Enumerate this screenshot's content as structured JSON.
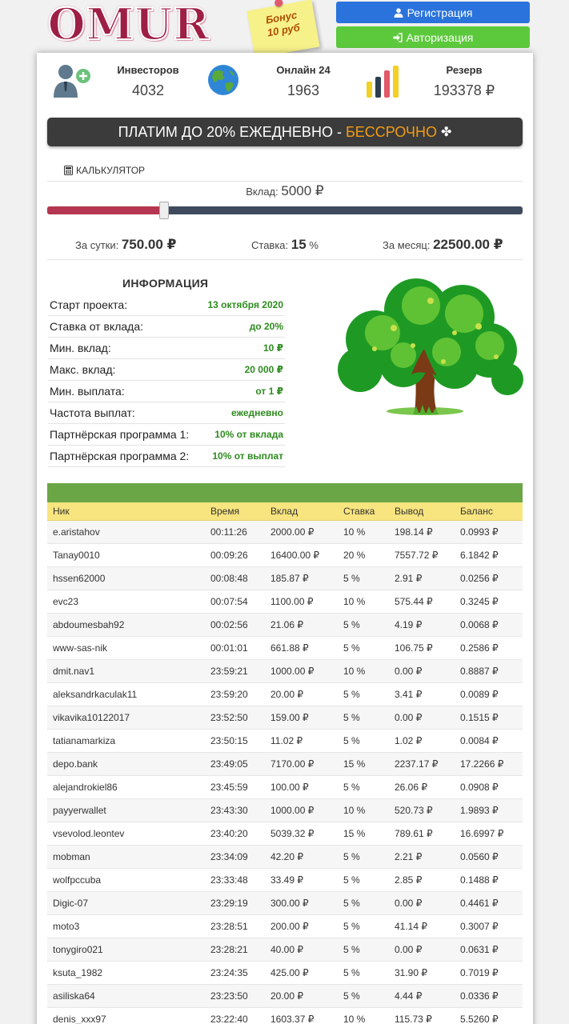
{
  "header": {
    "logo_text": "OMUR",
    "bonus_line1": "Бонус",
    "bonus_line2": "10 руб",
    "register_label": "Регистрация",
    "login_label": "Авторизация"
  },
  "stats": {
    "investors_label": "Инвесторов",
    "investors_value": "4032",
    "online_label": "Онлайн 24",
    "online_value": "1963",
    "reserve_label": "Резерв",
    "reserve_value": "193378 ₽"
  },
  "banner": {
    "text": "ПЛАТИМ ДО 20% ЕЖЕДНЕВНО -",
    "accent": "БЕССРОЧНО"
  },
  "calculator": {
    "title": "КАЛЬКУЛЯТОР",
    "deposit_label": "Вклад:",
    "deposit_value": "5000 ₽",
    "slider_fraction": 0.246,
    "daily_label": "За сутки:",
    "daily_value": "750.00 ₽",
    "rate_label": "Ставка:",
    "rate_value": "15",
    "rate_unit": "%",
    "monthly_label": "За месяц:",
    "monthly_value": "22500.00 ₽"
  },
  "info": {
    "title": "ИНФОРМАЦИЯ",
    "rows": [
      {
        "label": "Старт проекта:",
        "value": "13 октября 2020"
      },
      {
        "label": "Ставка от вклада:",
        "value": "до 20%"
      },
      {
        "label": "Мин. вклад:",
        "value": "10 ₽"
      },
      {
        "label": "Макс. вклад:",
        "value": "20 000 ₽"
      },
      {
        "label": "Мин. выплата:",
        "value": "от 1 ₽"
      },
      {
        "label": "Частота выплат:",
        "value": "ежедневно"
      },
      {
        "label": "Партнёрская программа 1:",
        "value": "10% от вклада"
      },
      {
        "label": "Партнёрская программа 2:",
        "value": "10% от выплат"
      }
    ]
  },
  "table": {
    "columns": [
      "Ник",
      "Время",
      "Вклад",
      "Ставка",
      "Вывод",
      "Баланс"
    ],
    "rows": [
      [
        "e.aristahov",
        "00:11:26",
        "2000.00 ₽",
        "10 %",
        "198.14 ₽",
        "0.0993 ₽"
      ],
      [
        "Tanay0010",
        "00:09:26",
        "16400.00 ₽",
        "20 %",
        "7557.72 ₽",
        "6.1842 ₽"
      ],
      [
        "hssen62000",
        "00:08:48",
        "185.87 ₽",
        "5 %",
        "2.91 ₽",
        "0.0256 ₽"
      ],
      [
        "evc23",
        "00:07:54",
        "1100.00 ₽",
        "10 %",
        "575.44 ₽",
        "0.3245 ₽"
      ],
      [
        "abdoumesbah92",
        "00:02:56",
        "21.06 ₽",
        "5 %",
        "4.19 ₽",
        "0.0068 ₽"
      ],
      [
        "www-sas-nik",
        "00:01:01",
        "661.88 ₽",
        "5 %",
        "106.75 ₽",
        "0.2586 ₽"
      ],
      [
        "dmit.nav1",
        "23:59:21",
        "1000.00 ₽",
        "10 %",
        "0.00 ₽",
        "0.8887 ₽"
      ],
      [
        "aleksandrkaculak11",
        "23:59:20",
        "20.00 ₽",
        "5 %",
        "3.41 ₽",
        "0.0089 ₽"
      ],
      [
        "vikavika10122017",
        "23:52:50",
        "159.00 ₽",
        "5 %",
        "0.00 ₽",
        "0.1515 ₽"
      ],
      [
        "tatianamarkiza",
        "23:50:15",
        "11.02 ₽",
        "5 %",
        "1.02 ₽",
        "0.0084 ₽"
      ],
      [
        "depo.bank",
        "23:49:05",
        "7170.00 ₽",
        "15 %",
        "2237.17 ₽",
        "17.2266 ₽"
      ],
      [
        "alejandrokiel86",
        "23:45:59",
        "100.00 ₽",
        "5 %",
        "26.06 ₽",
        "0.0908 ₽"
      ],
      [
        "payyerwallet",
        "23:43:30",
        "1000.00 ₽",
        "10 %",
        "520.73 ₽",
        "1.9893 ₽"
      ],
      [
        "vsevolod.leontev",
        "23:40:20",
        "5039.32 ₽",
        "15 %",
        "789.61 ₽",
        "16.6997 ₽"
      ],
      [
        "mobman",
        "23:34:09",
        "42.20 ₽",
        "5 %",
        "2.21 ₽",
        "0.0560 ₽"
      ],
      [
        "wolfpccuba",
        "23:33:48",
        "33.49 ₽",
        "5 %",
        "2.85 ₽",
        "0.1488 ₽"
      ],
      [
        "Digic-07",
        "23:29:19",
        "300.00 ₽",
        "5 %",
        "0.00 ₽",
        "0.4461 ₽"
      ],
      [
        "moto3",
        "23:28:51",
        "200.00 ₽",
        "5 %",
        "41.14 ₽",
        "0.3007 ₽"
      ],
      [
        "tonygiro021",
        "23:28:21",
        "40.00 ₽",
        "5 %",
        "0.00 ₽",
        "0.0631 ₽"
      ],
      [
        "ksuta_1982",
        "23:24:35",
        "425.00 ₽",
        "5 %",
        "31.90 ₽",
        "0.7019 ₽"
      ],
      [
        "asiliska64",
        "23:23:50",
        "20.00 ₽",
        "5 %",
        "4.44 ₽",
        "0.0336 ₽"
      ],
      [
        "denis_xxx97",
        "23:22:40",
        "1603.37 ₽",
        "10 %",
        "115.73 ₽",
        "5.5260 ₽"
      ]
    ]
  }
}
